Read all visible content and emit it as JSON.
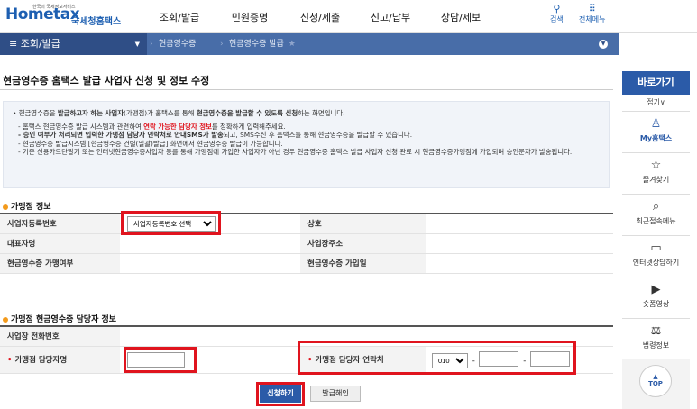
{
  "header": {
    "logo_small": "한국의 국세정보서비스",
    "logo_mark": "Hometax",
    "logo_sub": "국세청홈택스",
    "nav": [
      "조회/발급",
      "민원증명",
      "신청/제출",
      "신고/납부",
      "상담/제보"
    ],
    "search_label": "검색",
    "menu_label": "전체메뉴"
  },
  "navbar": {
    "home_label": "조회/발급",
    "crumb1": "현금영수증",
    "crumb2": "현금영수증 발급",
    "star": "★"
  },
  "page": {
    "title": "현금영수증 홈택스 발급 사업자 신청 및 정보 수정"
  },
  "info": {
    "p1a": "• 현금영수증을 ",
    "p1b": "발급하고자 하는 사업자",
    "p1c": "(가맹점)가 홈택스를 통해 ",
    "p1d": "현금영수증을 발급할 수 있도록 신청",
    "p1e": "하는 화면입니다.",
    "p2a": "- 홈택스 현금영수증 발급 시스템과 관련하여 ",
    "p2b": "연락 가능한 담당자 정보",
    "p2c": "를 정확하게 입력해주세요.",
    "p3a": "- 승인 여부가 처리되면 입력한 가맹점 담당자 연락처로 안내SMS가 발송",
    "p3b": "되고, SMS수신 후 홈택스를 통해 현금영수증을 발급할 수 있습니다.",
    "p4": "- 현금영수증 발급시스템 [현금영수증 건별(일괄)발급] 화면에서 현금영수증 발급이 가능합니다.",
    "p5": "- 기존 신용카드단말기 또는 인터넷현금영수증사업자 등를 통해 가맹점에 가입한 사업자가 아닌 경우 현금영수증 홈택스 발급 사업자 신청 완료 시 현금영수증가맹점에 가입되며 승인문자가 발송됩니다."
  },
  "merchant": {
    "section_title": "가맹점 정보",
    "biz_no_label": "사업자등록번호",
    "biz_no_select": "사업자등록번호 선택",
    "name_label": "상호",
    "rep_label": "대표자명",
    "addr_label": "사업장주소",
    "joined_label": "현금영수증 가맹여부",
    "join_date_label": "현금영수증 가입일"
  },
  "contact": {
    "section_title": "가맹점 현금영수증 담당자 정보",
    "phone_label": "사업장 전화번호",
    "manager_name_label": "가맹점 담당자명",
    "manager_phone_label": "가맹점 담당자 연락처",
    "phone_prefix": "010",
    "dash": "-"
  },
  "actions": {
    "apply": "신청하기",
    "stop": "발급해인"
  },
  "rail": {
    "title": "바로가기",
    "fold": "접기∨",
    "items": [
      "My홈택스",
      "즐겨찾기",
      "최근접속메뉴",
      "인터넷상담하기",
      "숏폼영상",
      "법령정보"
    ],
    "top": "TOP"
  },
  "colors": {
    "brand": "#1d5fb1",
    "navbar": "#486da8",
    "highlight": "#e0141e"
  }
}
